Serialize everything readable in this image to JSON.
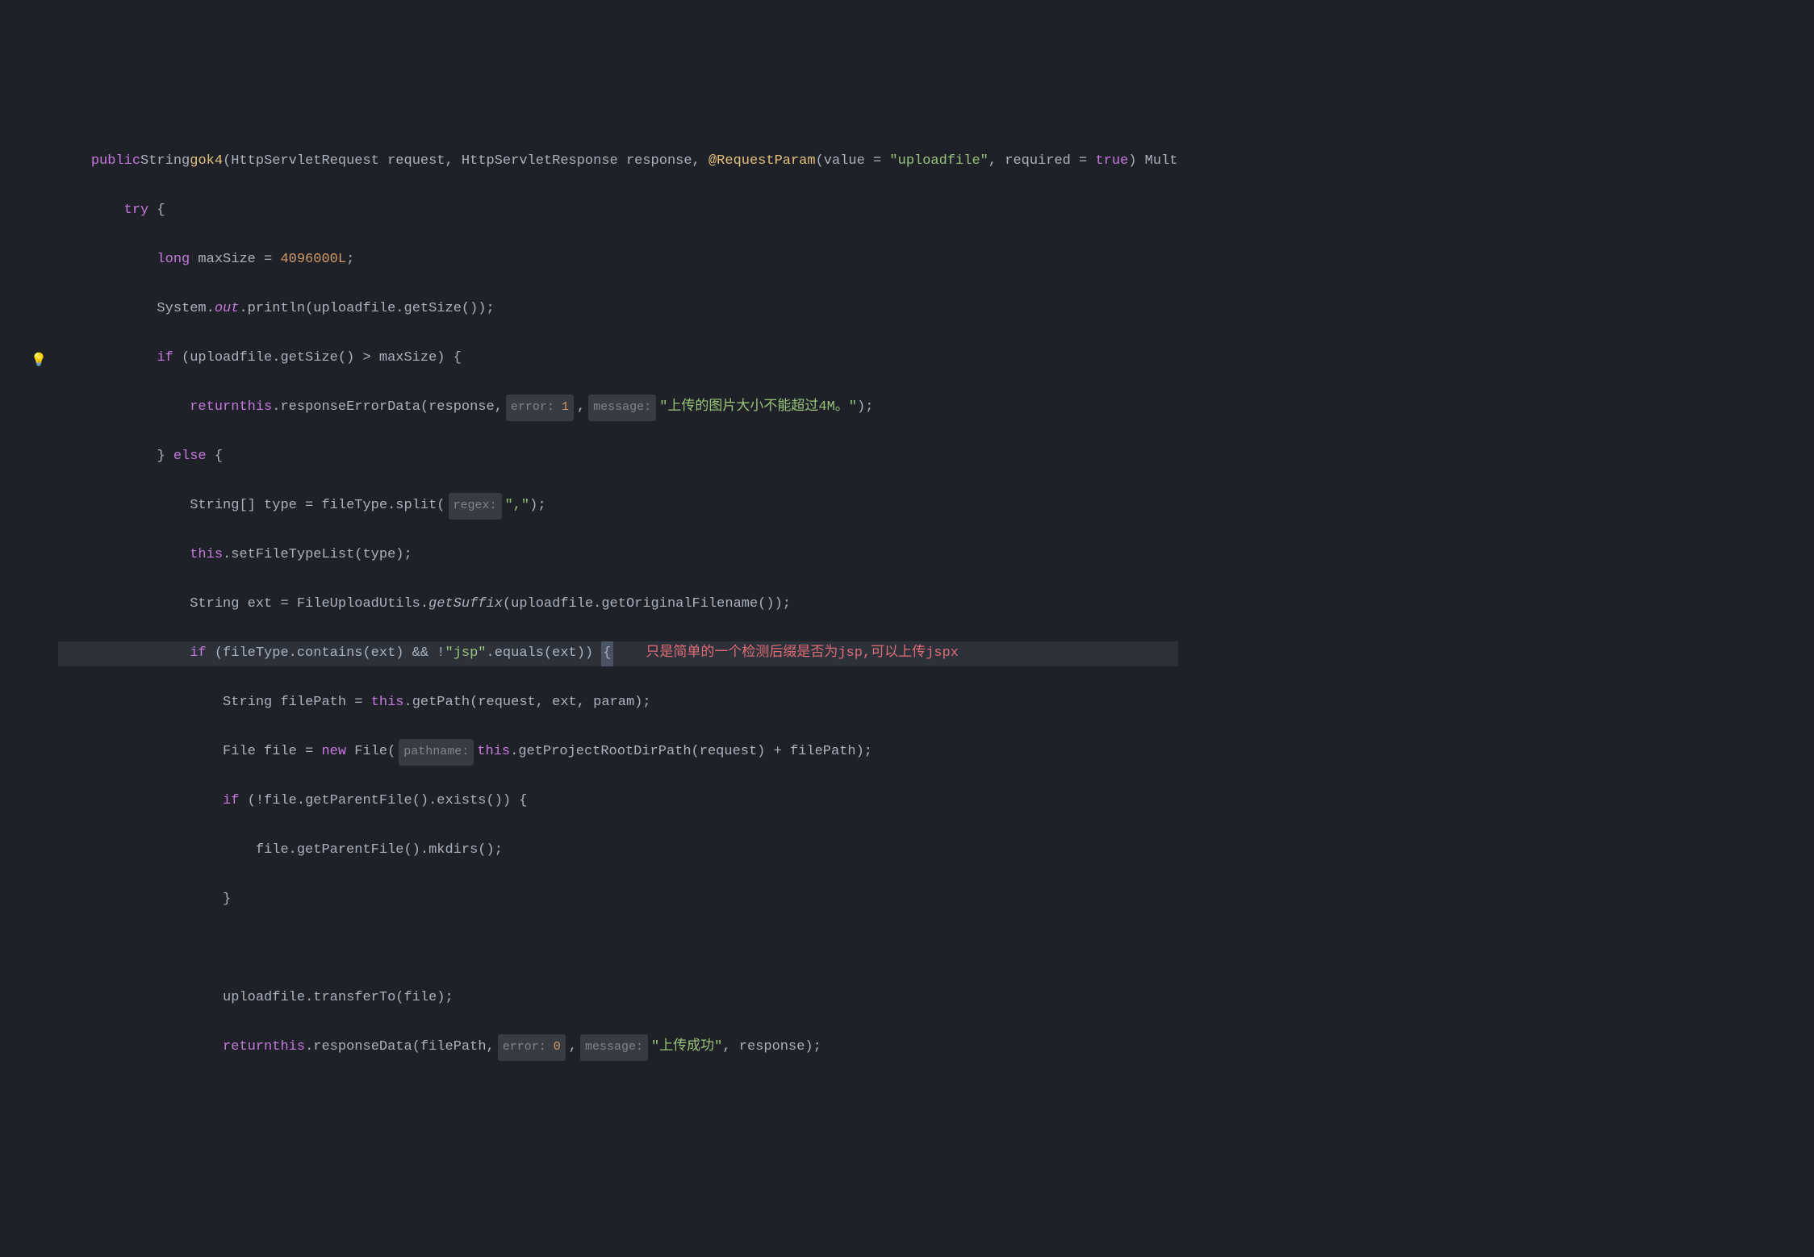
{
  "code": {
    "l1": {
      "indent": "    ",
      "kw_public": "public",
      "type_string": "String",
      "method_name": "gok4",
      "p1": "(HttpServletRequest request, HttpServletResponse response, ",
      "anno": "@RequestParam",
      "p2": "(value = ",
      "str_upload": "\"uploadfile\"",
      "p3": ", required = ",
      "kw_true": "true",
      "p4": ") Mult"
    },
    "l2": {
      "indent": "        ",
      "kw_try": "try",
      "brace": " {"
    },
    "l3": {
      "indent": "            ",
      "kw_long": "long",
      "var": " maxSize = ",
      "num": "4096000L",
      "semi": ";"
    },
    "l4": {
      "indent": "            ",
      "sys": "System.",
      "out": "out",
      "println": ".println(uploadfile.getSize());"
    },
    "l5": {
      "indent": "            ",
      "kw_if": "if",
      "cond": " (uploadfile.getSize() > maxSize) {"
    },
    "l6": {
      "indent": "                ",
      "kw_return": "return",
      "kw_this": "this",
      "call": ".responseErrorData(response,",
      "hint_error": "error:",
      "val_error": "1",
      "comma": ",",
      "hint_message": "message:",
      "str_msg": "\"上传的图片大小不能超过4M。\"",
      "end": ");"
    },
    "l7": {
      "indent": "            ",
      "brace": "} ",
      "kw_else": "else",
      "brace2": " {"
    },
    "l8": {
      "indent": "                ",
      "decl": "String[] type = fileType.split(",
      "hint_regex": "regex:",
      "str_comma": "\",\"",
      "end": ");"
    },
    "l9": {
      "indent": "                ",
      "kw_this": "this",
      "call": ".setFileTypeList(type);"
    },
    "l10": {
      "indent": "                ",
      "decl": "String ext = FileUploadUtils.",
      "method_ital": "getSuffix",
      "rest": "(uploadfile.getOriginalFilename());"
    },
    "l11": {
      "indent": "                ",
      "kw_if": "if",
      "p1": " (fileType.contains(ext) && !",
      "str_jsp": "\"jsp\"",
      "p2": ".equals(ext)) ",
      "brace": "{",
      "comment": "    只是简单的一个检测后缀是否为jsp,可以上传jspx"
    },
    "l12": {
      "indent": "                    ",
      "decl": "String filePath = ",
      "kw_this": "this",
      "call": ".getPath(request, ext, param);"
    },
    "l13": {
      "indent": "                    ",
      "decl": "File file = ",
      "kw_new": "new",
      "cls": " File(",
      "hint_path": "pathname:",
      "kw_this": "this",
      "call": ".getProjectRootDirPath(request) + filePath);"
    },
    "l14": {
      "indent": "                    ",
      "kw_if": "if",
      "cond": " (!file.getParentFile().exists()) {"
    },
    "l15": {
      "indent": "                        ",
      "call": "file.getParentFile().mkdirs();"
    },
    "l16": {
      "indent": "                    ",
      "brace": "}"
    },
    "l17": {
      "indent": "",
      "blank": ""
    },
    "l18": {
      "indent": "                    ",
      "call": "uploadfile.transferTo(file);"
    },
    "l19": {
      "indent": "                    ",
      "kw_return": "return",
      "kw_this": "this",
      "call": ".responseData(filePath,",
      "hint_error": "error:",
      "val_error": "0",
      "comma": ",",
      "hint_message": "message:",
      "str_msg": "\"上传成功\"",
      "end": ", response);"
    }
  }
}
